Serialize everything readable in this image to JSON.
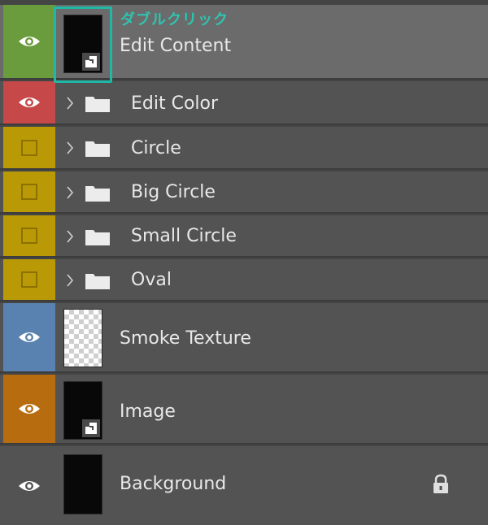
{
  "annotation": {
    "text": "ダブルクリック"
  },
  "colors": {
    "accent_highlight": "#21b7a7",
    "green_tag": "#6a9b3c",
    "red_tag": "#c64848",
    "yellow_tag": "#b99a06",
    "blue_tag": "#5a82b0",
    "orange_tag": "#b86c10",
    "none_tag": "#535353"
  },
  "layers": [
    {
      "name": "Edit Content",
      "type": "smart-object",
      "visible": true,
      "selected": true,
      "color_tag": "green"
    },
    {
      "name": "Edit Color",
      "type": "group",
      "visible": true,
      "color_tag": "red"
    },
    {
      "name": "Circle",
      "type": "group",
      "visible": false,
      "color_tag": "yellow"
    },
    {
      "name": "Big Circle",
      "type": "group",
      "visible": false,
      "color_tag": "yellow"
    },
    {
      "name": "Small Circle",
      "type": "group",
      "visible": false,
      "color_tag": "yellow"
    },
    {
      "name": "Oval",
      "type": "group",
      "visible": false,
      "color_tag": "yellow"
    },
    {
      "name": "Smoke Texture",
      "type": "pixel",
      "visible": true,
      "color_tag": "blue"
    },
    {
      "name": "Image",
      "type": "smart-object",
      "visible": true,
      "color_tag": "orange"
    },
    {
      "name": "Background",
      "type": "background",
      "visible": true,
      "locked": true,
      "color_tag": "none"
    }
  ]
}
